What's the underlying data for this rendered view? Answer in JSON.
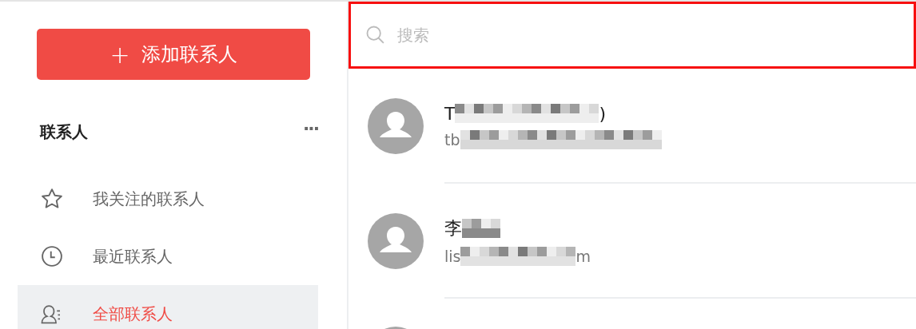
{
  "sidebar": {
    "add_button": {
      "icon": "+",
      "label": "添加联系人"
    },
    "section": {
      "title": "联系人",
      "more": "···"
    },
    "items": [
      {
        "kind": "star",
        "label": "我关注的联系人",
        "selected": false
      },
      {
        "kind": "clock",
        "label": "最近联系人",
        "selected": false
      },
      {
        "kind": "contacts",
        "label": "全部联系人",
        "selected": true
      }
    ]
  },
  "search": {
    "placeholder": "搜索"
  },
  "contacts": [
    {
      "kind": "contact",
      "name_start": "T",
      "name_end": ")",
      "email_start": "tb"
    },
    {
      "kind": "contact",
      "name_start": "李",
      "email_start": "lis",
      "email_end": "m"
    },
    {
      "kind": "partial"
    }
  ]
}
